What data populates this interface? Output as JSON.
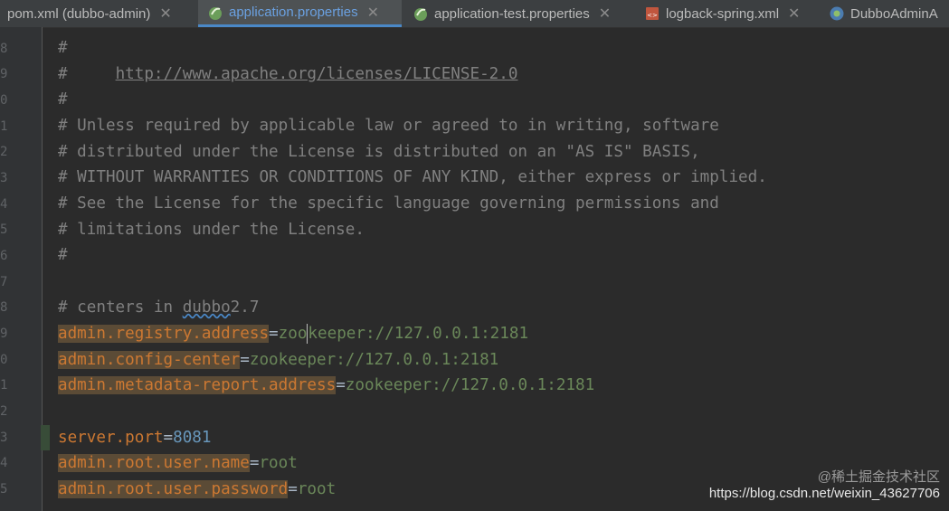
{
  "tabs": [
    {
      "label": "pom.xml (dubbo-admin)",
      "icon": "maven-file-icon",
      "active": false
    },
    {
      "label": "application.properties",
      "icon": "spring-properties-icon",
      "active": true
    },
    {
      "label": "application-test.properties",
      "icon": "spring-properties-icon",
      "active": false
    },
    {
      "label": "logback-spring.xml",
      "icon": "xml-file-icon",
      "active": false
    },
    {
      "label": "DubboAdminA",
      "icon": "spring-boot-icon",
      "active": false
    }
  ],
  "gutter": {
    "line_digits": [
      "",
      "8",
      "9",
      "0",
      "1",
      "2",
      "3",
      "4",
      "5",
      "6",
      "7",
      "8",
      "9",
      "0",
      "1",
      "2",
      "3",
      "4",
      "5",
      "6"
    ]
  },
  "editor": {
    "lines": [
      {
        "text": "#"
      },
      {
        "prefix": "#     ",
        "link": "http://www.apache.org/licenses/LICENSE-2.0"
      },
      {
        "text": "#"
      },
      {
        "text": "# Unless required by applicable law or agreed to in writing, software"
      },
      {
        "text": "# distributed under the License is distributed on an \"AS IS\" BASIS,"
      },
      {
        "text": "# WITHOUT WARRANTIES OR CONDITIONS OF ANY KIND, either express or implied."
      },
      {
        "text": "# See the License for the specific language governing permissions and"
      },
      {
        "text": "# limitations under the License."
      },
      {
        "text": "#"
      },
      {
        "text": ""
      },
      {
        "prefix": "# centers in ",
        "squiggle": "dubbo",
        "suffix": "2.7"
      },
      {
        "key": "admin.registry.address",
        "eq": "=",
        "value_a": "zoo",
        "value_b": "keeper://127.0.0.1:2181"
      },
      {
        "key": "admin.config-center",
        "eq": "=",
        "value": "zookeeper://127.0.0.1:2181"
      },
      {
        "key": "admin.metadata-report.address",
        "eq": "=",
        "value": "zookeeper://127.0.0.1:2181"
      },
      {
        "text": ""
      },
      {
        "key": "server.port",
        "eq": "=",
        "num": "8081"
      },
      {
        "key": "admin.root.user.name",
        "eq": "=",
        "value": "root"
      },
      {
        "key": "admin.root.user.password",
        "eq": "=",
        "value": "root"
      }
    ]
  },
  "watermark": {
    "line1": "@稀土掘金技术社区",
    "line2": "https://blog.csdn.net/weixin_43627706"
  }
}
